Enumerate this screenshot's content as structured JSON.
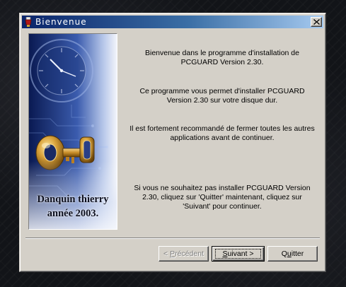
{
  "window": {
    "title": "Bienvenue",
    "close_glyph": "✕"
  },
  "banner": {
    "caption_line1": "Danquin thierry",
    "caption_line2": "année 2003.",
    "image": "golden-key-clock-blue-banner"
  },
  "messages": [
    {
      "line1": "Bienvenue dans le programme d'installation de",
      "line2": "PCGUARD Version 2.30."
    },
    {
      "line1": "Ce programme vous permet d'installer PCGUARD",
      "line2": "Version 2.30 sur votre disque dur."
    },
    {
      "line1": "Il est fortement recommandé de fermer toutes les autres",
      "line2": "applications avant de continuer."
    },
    {
      "line1": "Si vous ne souhaitez pas installer PCGUARD Version",
      "line2": "2.30, cliquez sur 'Quitter' maintenant, cliquez sur",
      "line3": "'Suivant' pour continuer."
    }
  ],
  "buttons": {
    "previous": {
      "prefix": "< ",
      "mnemonic": "P",
      "rest": "récédent",
      "enabled": false
    },
    "next": {
      "mnemonic": "S",
      "rest": "uivant >",
      "enabled": true
    },
    "quit": {
      "prefix": "Q",
      "mnemonic": "u",
      "rest": "itter",
      "enabled": true
    }
  },
  "colors": {
    "titlebar_start": "#0a246a",
    "titlebar_end": "#a6caf0",
    "dialog_face": "#d4d0c8"
  }
}
